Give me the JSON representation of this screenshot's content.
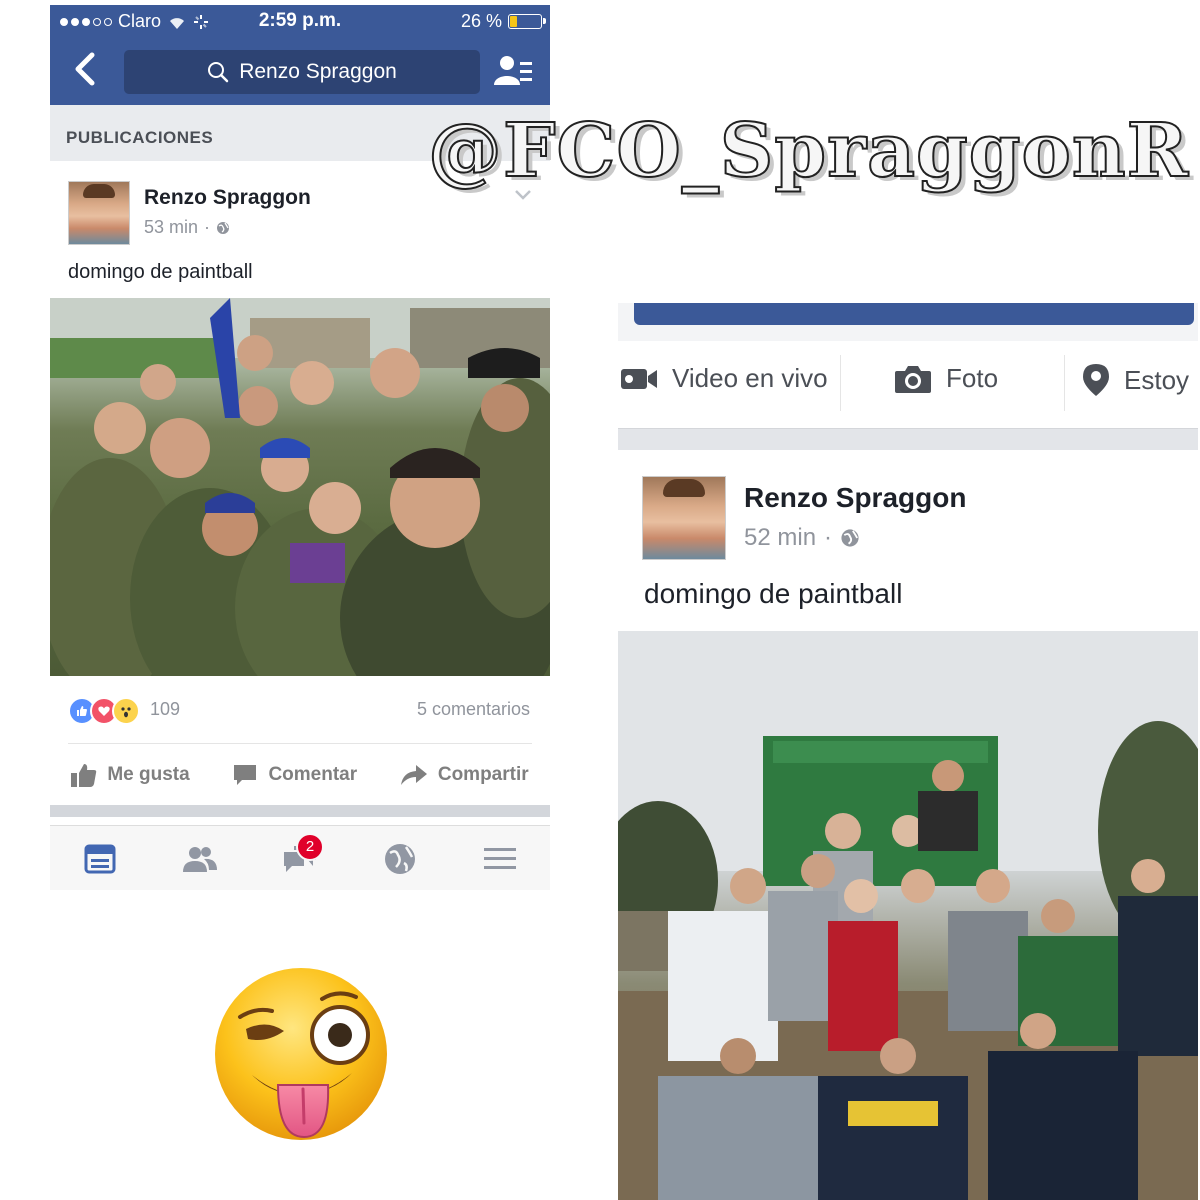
{
  "watermark": "@FCO_SpraggonR",
  "left_screenshot": {
    "status_bar": {
      "carrier": "Claro",
      "time": "2:59 p.m.",
      "battery": "26 %",
      "battery_level": 0.26
    },
    "nav": {
      "search_text": "Renzo Spraggon"
    },
    "section_header": "PUBLICACIONES",
    "post": {
      "author": "Renzo Spraggon",
      "time": "53 min",
      "separator": "·",
      "text": "domingo de paintball",
      "reaction_count": "109",
      "comments": "5 comentarios",
      "actions": {
        "like": "Me gusta",
        "comment": "Comentar",
        "share": "Compartir"
      }
    },
    "tabbar": {
      "tabs": [
        "news-feed",
        "friend-requests",
        "messages",
        "notifications",
        "more"
      ],
      "messages_badge": "2"
    }
  },
  "right_screenshot": {
    "composer": {
      "live": "Video en vivo",
      "photo": "Foto",
      "checkin": "Estoy"
    },
    "post": {
      "author": "Renzo Spraggon",
      "time": "52 min",
      "separator": "·",
      "text": "domingo de paintball"
    }
  },
  "colors": {
    "facebook_blue": "#3b5998",
    "badge_red": "#e0002a"
  }
}
